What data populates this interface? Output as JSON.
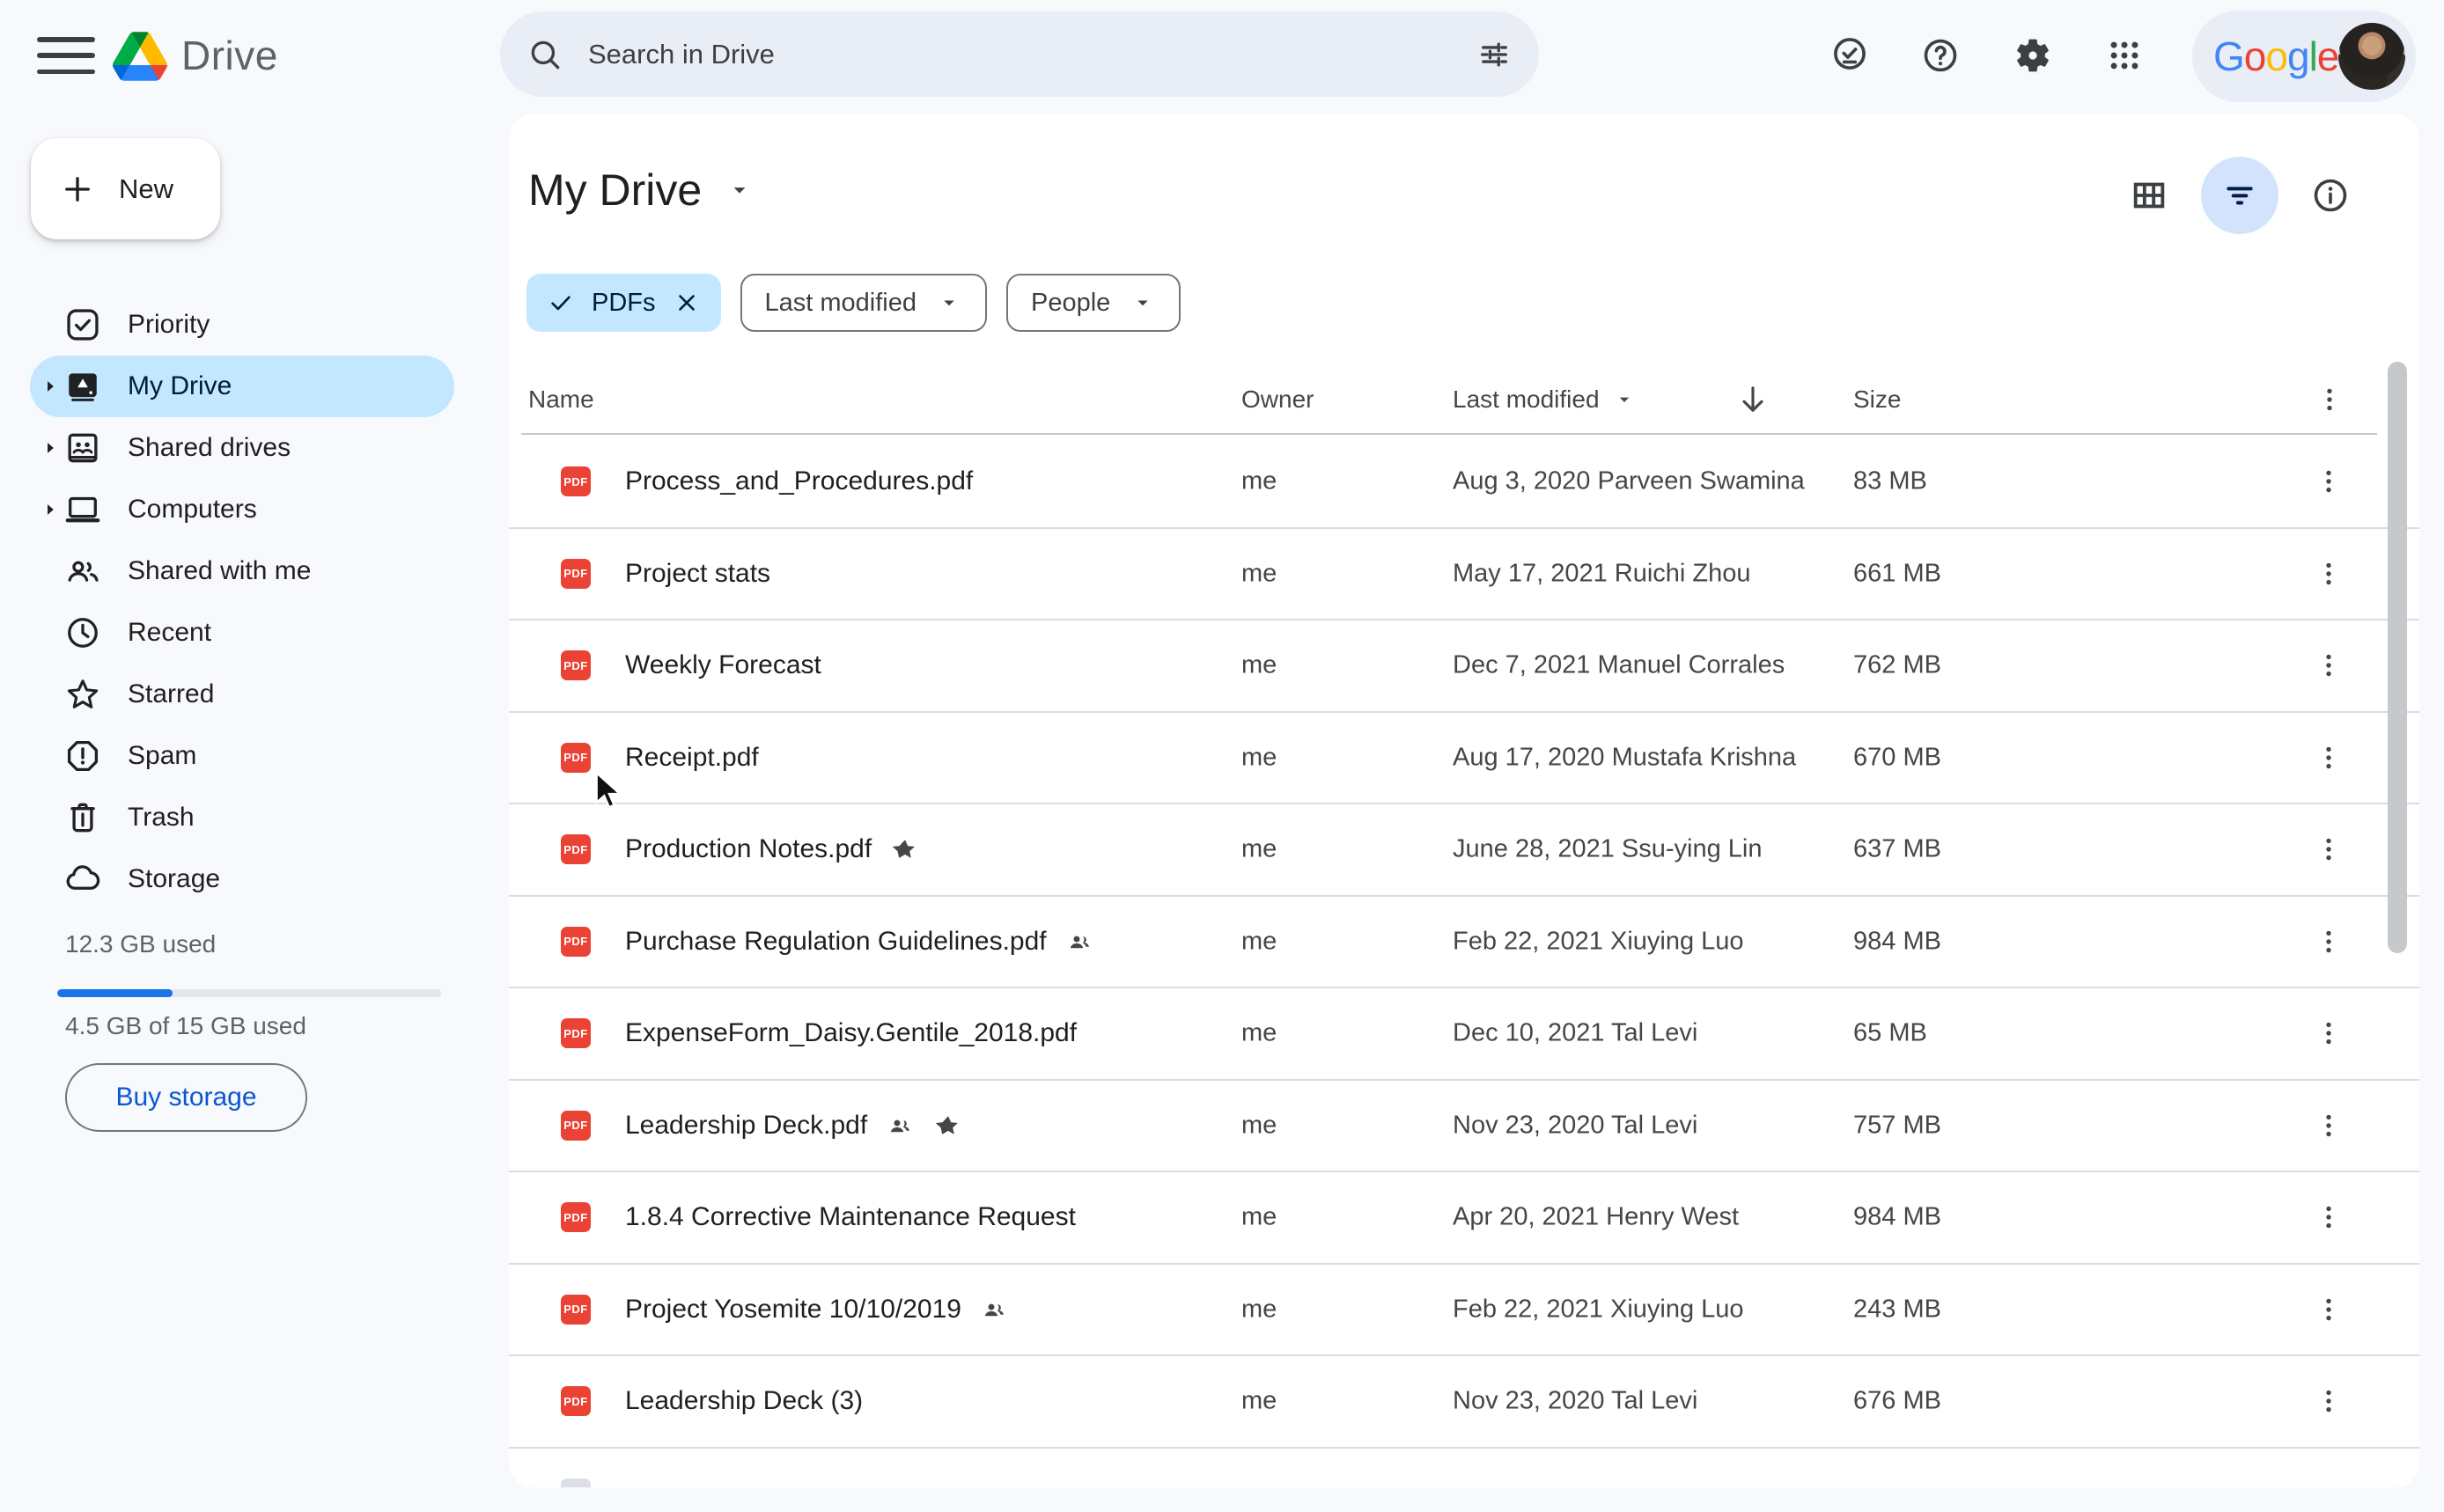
{
  "topbar": {
    "wordmark": "Drive",
    "search": {
      "placeholder": "Search in Drive"
    }
  },
  "account": {
    "google_letters": [
      {
        "ch": "G",
        "color": "#4285F4"
      },
      {
        "ch": "o",
        "color": "#EA4335"
      },
      {
        "ch": "o",
        "color": "#FBBC05"
      },
      {
        "ch": "g",
        "color": "#4285F4"
      },
      {
        "ch": "l",
        "color": "#34A853"
      },
      {
        "ch": "e",
        "color": "#EA4335"
      }
    ]
  },
  "sidebar": {
    "new_label": "New",
    "items": [
      {
        "label": "Priority",
        "icon": "priority",
        "selected": false,
        "expandable": false
      },
      {
        "label": "My Drive",
        "icon": "my-drive",
        "selected": true,
        "expandable": true
      },
      {
        "label": "Shared drives",
        "icon": "shared-drives",
        "selected": false,
        "expandable": true
      },
      {
        "label": "Computers",
        "icon": "computers",
        "selected": false,
        "expandable": true
      },
      {
        "label": "Shared with me",
        "icon": "shared-with-me",
        "selected": false,
        "expandable": false
      },
      {
        "label": "Recent",
        "icon": "recent",
        "selected": false,
        "expandable": false
      },
      {
        "label": "Starred",
        "icon": "starred",
        "selected": false,
        "expandable": false
      },
      {
        "label": "Spam",
        "icon": "spam",
        "selected": false,
        "expandable": false
      },
      {
        "label": "Trash",
        "icon": "trash",
        "selected": false,
        "expandable": false
      },
      {
        "label": "Storage",
        "icon": "storage",
        "selected": false,
        "expandable": false
      }
    ],
    "storage": {
      "used_line": "12.3 GB used",
      "quota_line": "4.5 GB of 15 GB used",
      "percent_used": 30,
      "buy_label": "Buy storage"
    }
  },
  "main": {
    "title": "My Drive",
    "chips": {
      "pdfs": {
        "label": "PDFs",
        "active": true
      },
      "last_modified": {
        "label": "Last modified"
      },
      "people": {
        "label": "People"
      }
    },
    "table": {
      "headers": {
        "name": "Name",
        "owner": "Owner",
        "last_modified": "Last modified",
        "size": "Size"
      },
      "sort": {
        "column": "Last modified",
        "direction": "desc"
      },
      "rows": [
        {
          "name": "Process_and_Procedures.pdf",
          "shared": false,
          "starred": false,
          "owner": "me",
          "modified": "Aug 3, 2020 Parveen Swamina",
          "size": "83 MB"
        },
        {
          "name": "Project stats",
          "shared": false,
          "starred": false,
          "owner": "me",
          "modified": "May 17, 2021 Ruichi Zhou",
          "size": "661 MB"
        },
        {
          "name": "Weekly Forecast",
          "shared": false,
          "starred": false,
          "owner": "me",
          "modified": "Dec 7, 2021 Manuel Corrales",
          "size": "762 MB"
        },
        {
          "name": "Receipt.pdf",
          "shared": false,
          "starred": false,
          "owner": "me",
          "modified": "Aug 17, 2020 Mustafa Krishna",
          "size": "670 MB"
        },
        {
          "name": "Production Notes.pdf",
          "shared": false,
          "starred": true,
          "owner": "me",
          "modified": "June 28, 2021 Ssu-ying Lin",
          "size": "637 MB"
        },
        {
          "name": "Purchase Regulation Guidelines.pdf",
          "shared": true,
          "starred": false,
          "owner": "me",
          "modified": "Feb 22, 2021 Xiuying Luo",
          "size": "984 MB"
        },
        {
          "name": "ExpenseForm_Daisy.Gentile_2018.pdf",
          "shared": false,
          "starred": false,
          "owner": "me",
          "modified": "Dec 10, 2021 Tal Levi",
          "size": "65 MB"
        },
        {
          "name": "Leadership Deck.pdf",
          "shared": true,
          "starred": true,
          "owner": "me",
          "modified": "Nov 23, 2020 Tal Levi",
          "size": "757 MB"
        },
        {
          "name": "1.8.4 Corrective Maintenance Request",
          "shared": false,
          "starred": false,
          "owner": "me",
          "modified": "Apr 20, 2021 Henry West",
          "size": "984 MB"
        },
        {
          "name": "Project Yosemite 10/10/2019",
          "shared": true,
          "starred": false,
          "owner": "me",
          "modified": "Feb 22, 2021 Xiuying Luo",
          "size": "243 MB"
        },
        {
          "name": "Leadership Deck (3)",
          "shared": false,
          "starred": false,
          "owner": "me",
          "modified": "Nov 23, 2020 Tal Levi",
          "size": "676 MB"
        }
      ]
    }
  },
  "colors": {
    "page_bg": "#f7f9fc",
    "card_bg": "#ffffff",
    "selection_blue": "#c2e7ff",
    "filter_active_bg": "#d3e3fd",
    "accent_blue": "#1a73e8",
    "buy_storage_text": "#0b57d0",
    "pdf_red": "#EA4335",
    "divider": "#dadce0"
  }
}
